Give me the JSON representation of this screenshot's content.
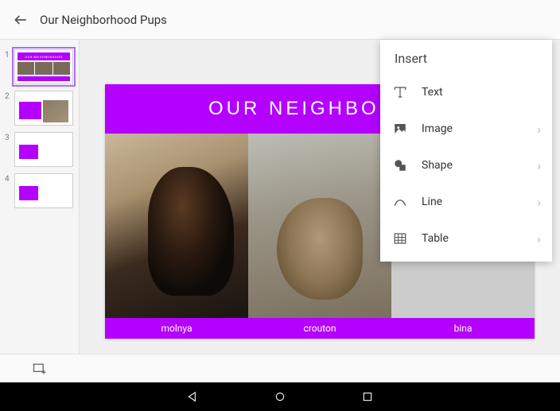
{
  "header": {
    "title": "Our Neighborhood Pups"
  },
  "slides": [
    {
      "num": "1",
      "selected": true
    },
    {
      "num": "2",
      "selected": false
    },
    {
      "num": "3",
      "selected": false
    },
    {
      "num": "4",
      "selected": false
    }
  ],
  "currentSlide": {
    "title": "our Neighborho",
    "captions": [
      "molnya",
      "crouton",
      "bina"
    ]
  },
  "insertMenu": {
    "title": "Insert",
    "items": [
      {
        "label": "Text",
        "icon": "text-icon",
        "arrow": false
      },
      {
        "label": "Image",
        "icon": "image-icon",
        "arrow": true
      },
      {
        "label": "Shape",
        "icon": "shape-icon",
        "arrow": true
      },
      {
        "label": "Line",
        "icon": "line-icon",
        "arrow": true
      },
      {
        "label": "Table",
        "icon": "table-icon",
        "arrow": true
      }
    ]
  }
}
